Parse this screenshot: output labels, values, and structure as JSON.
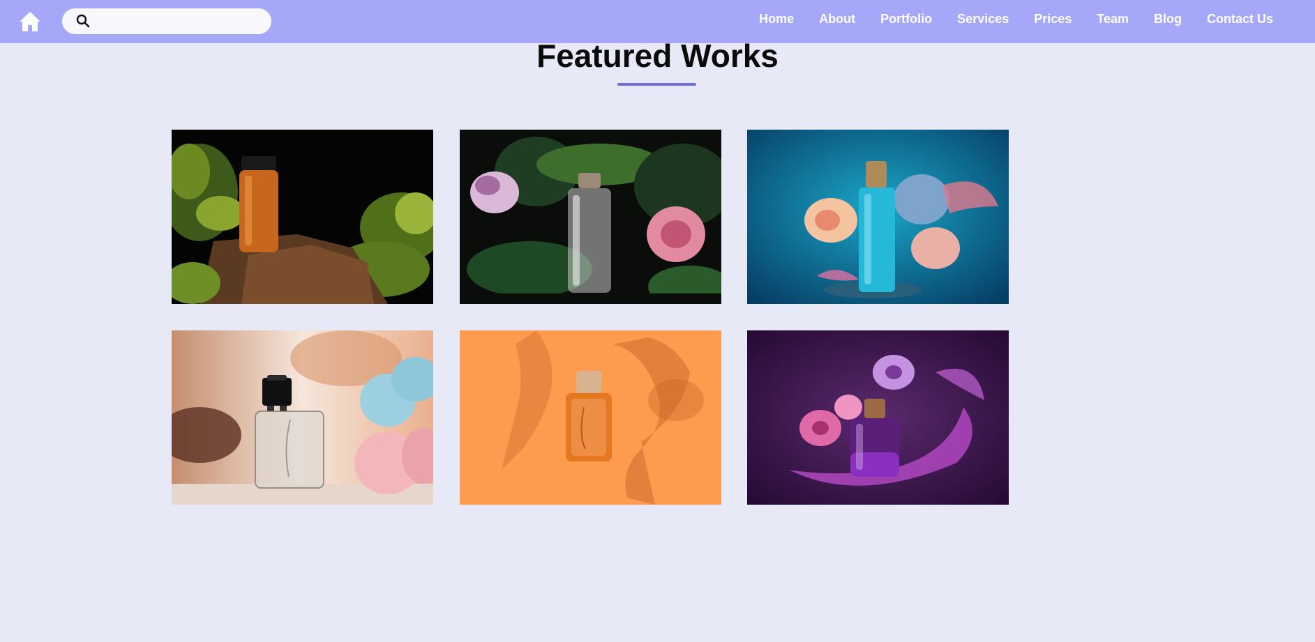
{
  "nav": {
    "home_icon": "home-icon",
    "search": {
      "placeholder": "",
      "value": "",
      "icon": "search-icon"
    },
    "links": [
      "Home",
      "About",
      "Portfolio",
      "Services",
      "Prices",
      "Team",
      "Blog",
      "Contact Us"
    ],
    "background": "#a5a8f8"
  },
  "main": {
    "title": "Featured Works",
    "accent": "#6f71d8",
    "background": "#e8e9f6",
    "works": [
      {
        "subject": "amber perfume bottle on rock with moss",
        "bg": "#050505"
      },
      {
        "subject": "clear perfume bottle with ferns and flowers",
        "bg": "#0b0f0c"
      },
      {
        "subject": "blue perfume bottle with flower splash",
        "bg": "#0e7fa3"
      },
      {
        "subject": "square clear perfume bottle with pastel flowers",
        "bg": "#f2d6c6"
      },
      {
        "subject": "orange perfume bottle with leaf shadow",
        "bg": "#ff9a4c"
      },
      {
        "subject": "purple perfume bottle with splash and flowers",
        "bg": "#3a1448"
      }
    ]
  }
}
